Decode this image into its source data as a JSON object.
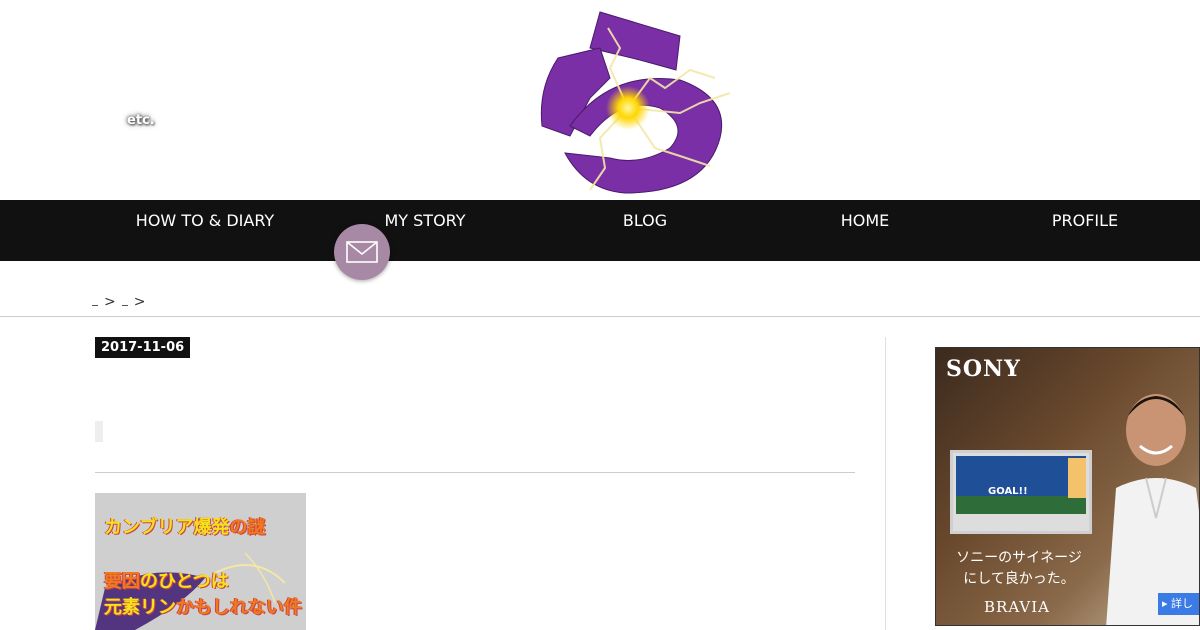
{
  "header": {
    "etc_label": "etc."
  },
  "nav": {
    "items": [
      {
        "label": "HOW TO & DIARY"
      },
      {
        "label": "MY STORY"
      },
      {
        "label": "BLOG"
      },
      {
        "label": "HOME"
      },
      {
        "label": "PROFILE"
      }
    ],
    "mail_icon": "envelope-icon"
  },
  "breadcrumb": {
    "separator": ">"
  },
  "article": {
    "date": "2017-11-06",
    "thumbnail": {
      "line1_a": "カンブリア爆発",
      "line1_b": "の謎",
      "line2_a": "要因",
      "line2_b": "のひとつは",
      "line3_a": "元素リン",
      "line3_b": "かもしれない件"
    }
  },
  "ad": {
    "brand": "SONY",
    "copy_line1": "ソニーのサイネージ",
    "copy_line2": "にして良かった。",
    "product": "BRAVIA",
    "more_label": "詳し",
    "tv_banner": "GOAL!!"
  },
  "colors": {
    "nav_bg": "#111111",
    "logo_purple": "#7a2fa6",
    "ad_button": "#3b7be6"
  }
}
